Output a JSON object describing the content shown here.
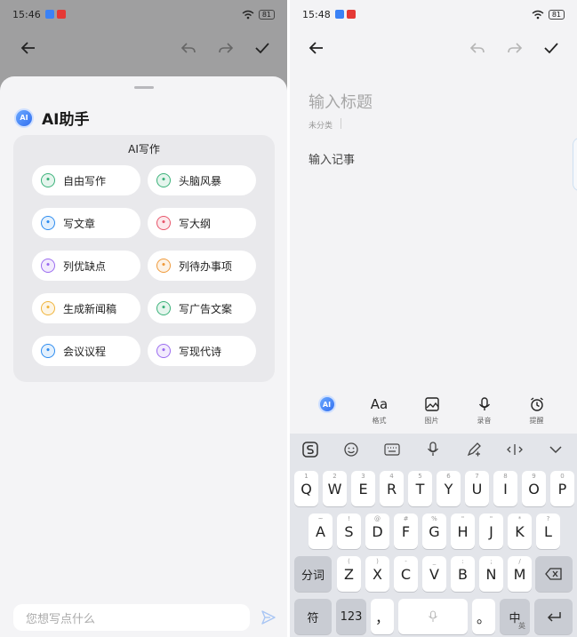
{
  "left": {
    "status": {
      "time": "15:46",
      "battery": "81"
    },
    "ai_title": "AI助手",
    "logo_text": "AI",
    "card_title": "AI写作",
    "chips": [
      {
        "label": "自由写作",
        "icon": "pen-leaf-icon",
        "color": "#3bb27a"
      },
      {
        "label": "头脑风暴",
        "icon": "ai-spark-icon",
        "color": "#3bb27a"
      },
      {
        "label": "写文章",
        "icon": "edit-document-icon",
        "color": "#2f8df0"
      },
      {
        "label": "写大纲",
        "icon": "outline-list-icon",
        "color": "#e8566b"
      },
      {
        "label": "列优缺点",
        "icon": "bullet-list-icon",
        "color": "#9b6cf0"
      },
      {
        "label": "列待办事项",
        "icon": "checklist-icon",
        "color": "#f09a3b"
      },
      {
        "label": "生成新闻稿",
        "icon": "newspaper-icon",
        "color": "#f0b43b"
      },
      {
        "label": "写广告文案",
        "icon": "megaphone-icon",
        "color": "#3bb27a"
      },
      {
        "label": "会议议程",
        "icon": "clipboard-icon",
        "color": "#2f8df0"
      },
      {
        "label": "写现代诗",
        "icon": "fan-icon",
        "color": "#9b6cf0"
      }
    ],
    "input_placeholder": "您想写点什么"
  },
  "right": {
    "status": {
      "time": "15:48",
      "battery": "81"
    },
    "title_placeholder": "输入标题",
    "category": "未分类",
    "body_placeholder": "输入记事",
    "logo_text": "AI",
    "tools": [
      {
        "label": "",
        "icon": "ai-assistant-icon"
      },
      {
        "label": "格式",
        "icon": "format-icon",
        "glyph": "Aa"
      },
      {
        "label": "图片",
        "icon": "image-icon"
      },
      {
        "label": "录音",
        "icon": "microphone-icon"
      },
      {
        "label": "提醒",
        "icon": "alarm-clock-icon"
      }
    ],
    "keyboard": {
      "row1": [
        [
          "Q",
          "1"
        ],
        [
          "W",
          "2"
        ],
        [
          "E",
          "3"
        ],
        [
          "R",
          "4"
        ],
        [
          "T",
          "5"
        ],
        [
          "Y",
          "6"
        ],
        [
          "U",
          "7"
        ],
        [
          "I",
          "8"
        ],
        [
          "O",
          "9"
        ],
        [
          "P",
          "0"
        ]
      ],
      "row2": [
        [
          "A",
          "~"
        ],
        [
          "S",
          "!"
        ],
        [
          "D",
          "@"
        ],
        [
          "F",
          "#"
        ],
        [
          "G",
          "%"
        ],
        [
          "H",
          "\""
        ],
        [
          "J",
          "\""
        ],
        [
          "K",
          "*"
        ],
        [
          "L",
          "?"
        ]
      ],
      "row3": [
        [
          "Z",
          "("
        ],
        [
          "X",
          ")"
        ],
        [
          "C",
          "-"
        ],
        [
          "V",
          "_"
        ],
        [
          "B",
          ":"
        ],
        [
          "N",
          ";"
        ],
        [
          "M",
          "/"
        ]
      ],
      "fenci": "分词",
      "fu": "符",
      "num": "123",
      "comma": "，",
      "period": "。",
      "lang_main": "中",
      "lang_sub": "英"
    }
  }
}
